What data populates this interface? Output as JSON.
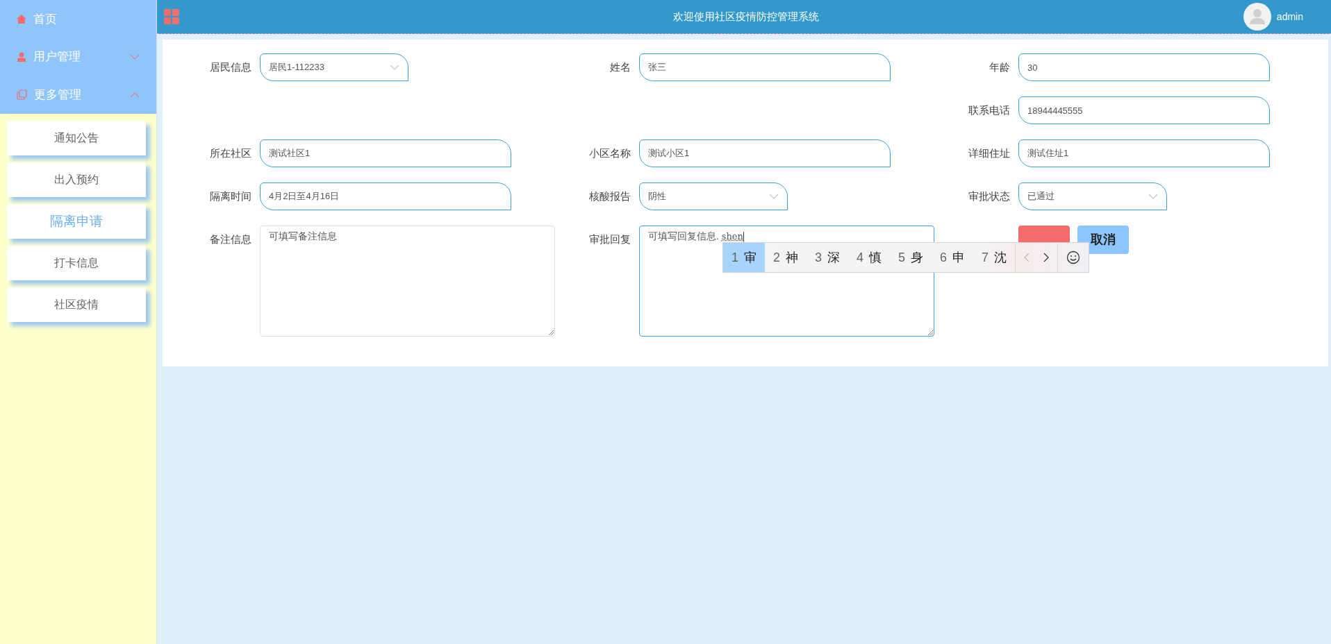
{
  "sidebar": {
    "items": [
      {
        "label": "首页",
        "kind": "link"
      },
      {
        "label": "用户管理",
        "kind": "group",
        "expanded": false
      },
      {
        "label": "更多管理",
        "kind": "group",
        "expanded": true,
        "children": [
          {
            "label": "通知公告",
            "selected": false
          },
          {
            "label": "出入预约",
            "selected": false
          },
          {
            "label": "隔离申请",
            "selected": true
          },
          {
            "label": "打卡信息",
            "selected": false
          },
          {
            "label": "社区疫情",
            "selected": false
          }
        ]
      }
    ]
  },
  "header": {
    "title": "欢迎使用社区疫情防控管理系统",
    "user": "admin"
  },
  "form": {
    "rows": [
      {
        "fields": [
          {
            "label": "居民信息",
            "kind": "select",
            "value": "居民1-112233"
          },
          {
            "label": "姓名",
            "kind": "input",
            "value": "张三"
          },
          {
            "label": "年龄",
            "kind": "input",
            "value": "30"
          }
        ]
      },
      {
        "fields": [
          {
            "label": "联系电话",
            "kind": "input",
            "value": "18944445555"
          }
        ]
      },
      {
        "fields": [
          {
            "label": "所在社区",
            "kind": "input",
            "value": "测试社区1"
          },
          {
            "label": "小区名称",
            "kind": "input",
            "value": "测试小区1"
          },
          {
            "label": "详细住址",
            "kind": "input",
            "value": "测试住址1"
          }
        ]
      },
      {
        "fields": [
          {
            "label": "隔离时间",
            "kind": "input",
            "value": "4月2日至4月16日"
          },
          {
            "label": "核酸报告",
            "kind": "select",
            "value": "阴性"
          },
          {
            "label": "审批状态",
            "kind": "select",
            "value": "已通过"
          }
        ]
      },
      {
        "fields": [
          {
            "label": "备注信息",
            "kind": "textarea",
            "value": "可填写备注信息",
            "focused": false
          },
          {
            "label": "审批回复",
            "kind": "textarea",
            "value": "可填写回复信息. ",
            "composition": "shen",
            "focused": true
          }
        ],
        "buttons": [
          {
            "kind": "danger"
          },
          {
            "label": "取消",
            "kind": "primary"
          }
        ]
      }
    ]
  },
  "ime": {
    "candidates": [
      {
        "index": "1",
        "char": "审",
        "selected": true
      },
      {
        "index": "2",
        "char": "神",
        "selected": false
      },
      {
        "index": "3",
        "char": "深",
        "selected": false
      },
      {
        "index": "4",
        "char": "慎",
        "selected": false
      },
      {
        "index": "5",
        "char": "身",
        "selected": false
      },
      {
        "index": "6",
        "char": "申",
        "selected": false
      },
      {
        "index": "7",
        "char": "沈",
        "selected": false
      }
    ]
  }
}
